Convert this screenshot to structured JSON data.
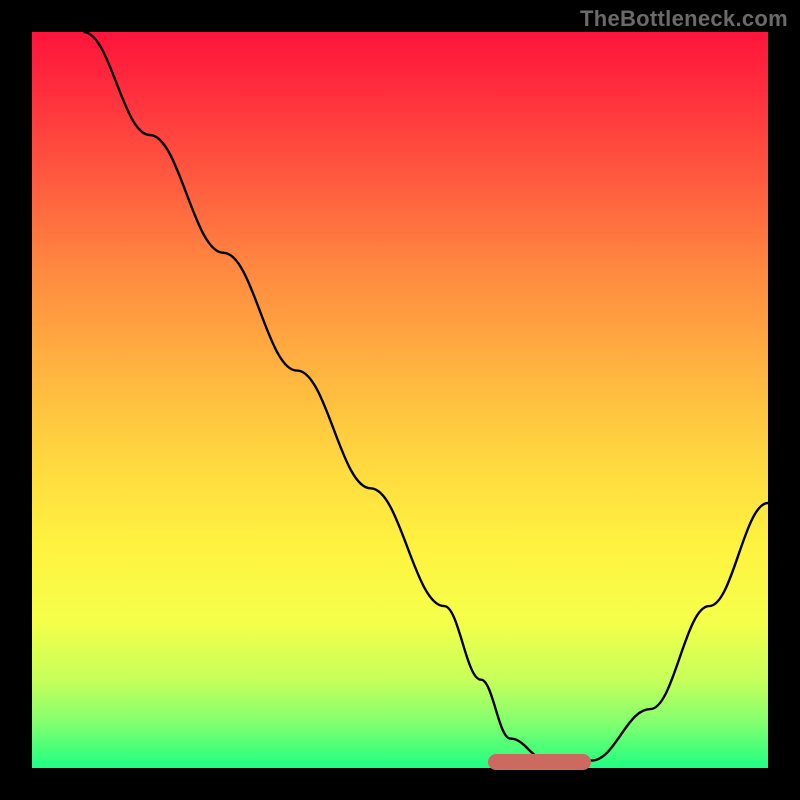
{
  "watermark": "TheBottleneck.com",
  "accent_color": "#cd6a60",
  "chart_data": {
    "type": "line",
    "title": "",
    "xlabel": "",
    "ylabel": "",
    "xlim": [
      0,
      100
    ],
    "ylim": [
      0,
      100
    ],
    "grid": false,
    "legend": false,
    "series": [
      {
        "name": "curve",
        "x": [
          7,
          16,
          26,
          36,
          46,
          56,
          61,
          65,
          70,
          76,
          84,
          92,
          100
        ],
        "y": [
          100,
          86,
          70,
          54,
          38,
          22,
          12,
          4,
          1,
          1,
          8,
          22,
          36
        ]
      }
    ],
    "optimum_band_x": [
      62,
      76
    ]
  }
}
